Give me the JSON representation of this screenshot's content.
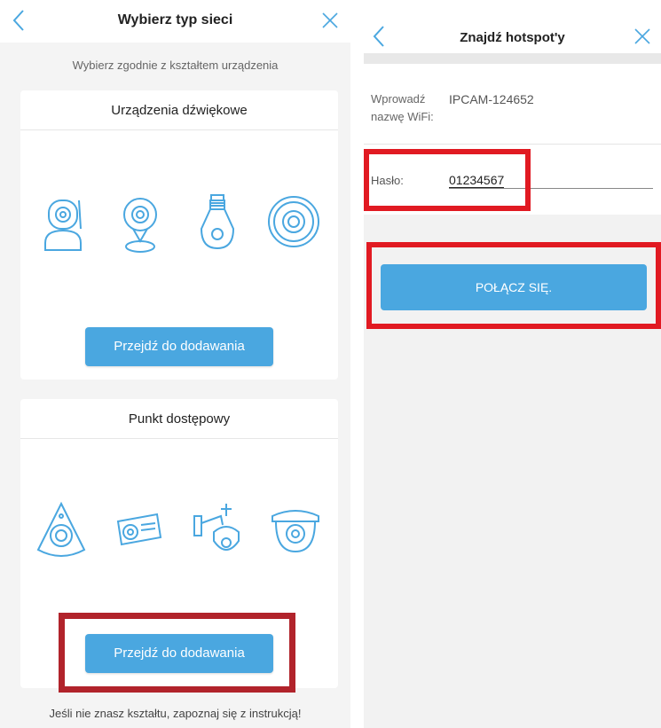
{
  "left": {
    "title": "Wybierz typ sieci",
    "subtitle": "Wybierz zgodnie z kształtem urządzenia",
    "section1": {
      "title": "Urządzenia dźwiękowe",
      "button_label": "Przejdź do dodawania",
      "icons": [
        "robot-camera-icon",
        "round-desk-camera-icon",
        "bulb-camera-icon",
        "round-fisheye-camera-icon"
      ]
    },
    "section2": {
      "title": "Punkt dostępowy",
      "button_label": "Przejdź do dodawania",
      "icons": [
        "fisheye-camera-icon",
        "bullet-camera-icon",
        "ptz-camera-icon",
        "dome-camera-icon"
      ]
    },
    "footer": "Jeśli nie znasz kształtu, zapoznaj się z instrukcją!"
  },
  "right": {
    "title": "Znajdź hotspot'y",
    "wifi_label": "Wprowadź nazwę WiFi:",
    "wifi_value": "IPCAM-124652",
    "password_label": "Hasło:",
    "password_value": "01234567",
    "connect_label": "POŁĄCZ SIĘ."
  },
  "colors": {
    "accent": "#4aa7e0",
    "highlight": "#e11a22",
    "icon_stroke": "#4aa7e0"
  }
}
